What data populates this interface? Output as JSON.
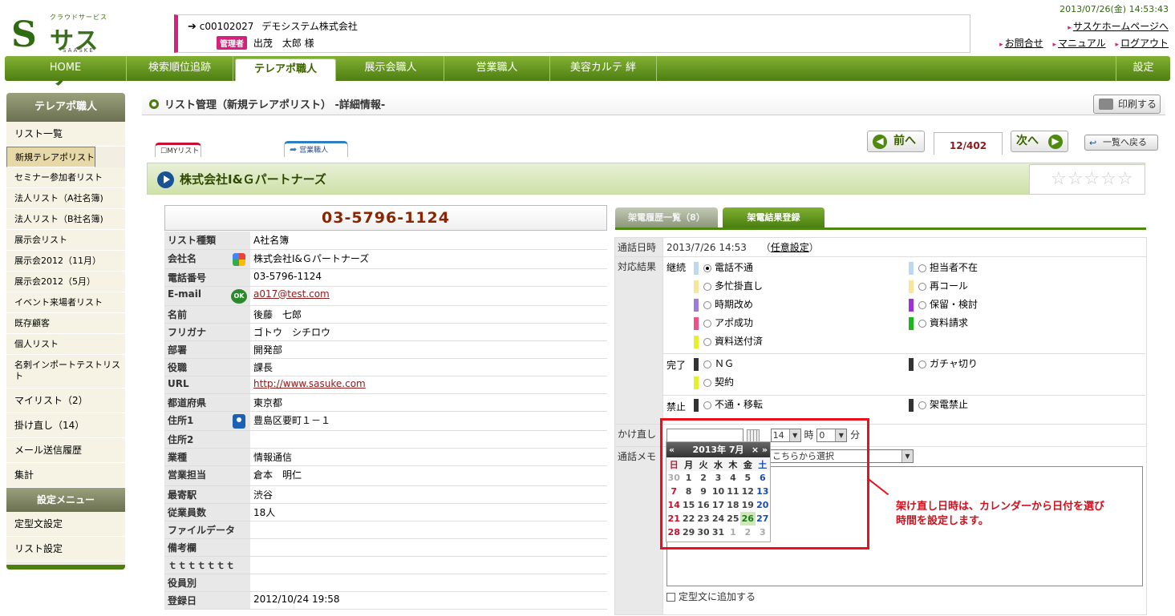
{
  "header": {
    "logo_sub": "クラウドサービス",
    "logo_main": "サスケ",
    "logo_en": "SAASKE",
    "account_id": "c00102027",
    "company": "デモシステム株式会社",
    "role_badge": "管理者",
    "user": "出茂　太郎 様",
    "datetime": "2013/07/26(金) 14:53:43",
    "links": [
      "サスケホームページへ",
      "お問合せ",
      "マニュアル",
      "ログアウト"
    ]
  },
  "nav": {
    "items": [
      "HOME",
      "検索順位追跡",
      "テレアポ職人",
      "展示会職人",
      "営業職人",
      "美容カルテ 絆"
    ],
    "active": "テレアポ職人",
    "settings": "設定"
  },
  "sidebar": {
    "title": "テレアポ職人",
    "items": [
      "リスト一覧",
      "新規テレアポリスト",
      "セミナー参加者リスト",
      "法人リスト（A社名簿)",
      "法人リスト（B社名簿)",
      "展示会リスト",
      "展示会2012（11月）",
      "展示会2012（5月）",
      "イベント来場者リスト",
      "既存顧客",
      "個人リスト",
      "名刺インポートテストリスト",
      "マイリスト（2）",
      "掛け直し（14）",
      "メール送信履歴",
      "集計"
    ],
    "selected": "新規テレアポリスト",
    "settings_title": "設定メニュー",
    "settings_items": [
      "定型文設定",
      "リスト設定"
    ]
  },
  "page": {
    "title": "リスト管理（新規テレアポリスト） -詳細情報-",
    "print": "印刷する",
    "tab_my": "MYリスト",
    "tab_sales": "営業職人",
    "prev": "前へ",
    "next": "次へ",
    "pager": "12/402",
    "back": "一覧へ戻る",
    "company_name": "株式会社I&Ｇパートナーズ",
    "stars": "☆☆☆☆☆",
    "phone": "03-5796-1124"
  },
  "info": [
    {
      "k": "リスト種類",
      "v": "A社名簿",
      "icon": ""
    },
    {
      "k": "会社名",
      "v": "株式会社I&Ｇパートナーズ",
      "icon": "g"
    },
    {
      "k": "電話番号",
      "v": "03-5796-1124",
      "icon": ""
    },
    {
      "k": "E-mail",
      "v": "a017@test.com",
      "icon": "m",
      "link": true
    },
    {
      "k": "名前",
      "v": "後藤　七郎",
      "icon": ""
    },
    {
      "k": "フリガナ",
      "v": "ゴトウ　シチロウ",
      "icon": ""
    },
    {
      "k": "部署",
      "v": "開発部",
      "icon": ""
    },
    {
      "k": "役職",
      "v": "課長",
      "icon": ""
    },
    {
      "k": "URL",
      "v": "http://www.sasuke.com",
      "icon": "",
      "link": true
    },
    {
      "k": "都道府県",
      "v": "東京都",
      "icon": ""
    },
    {
      "k": "住所1",
      "v": "豊島区要町１－１",
      "icon": "pin"
    },
    {
      "k": "住所2",
      "v": "",
      "icon": ""
    },
    {
      "k": "業種",
      "v": "情報通信",
      "icon": ""
    },
    {
      "k": "営業担当",
      "v": "倉本　明仁",
      "icon": ""
    },
    {
      "k": "最寄駅",
      "v": "渋谷",
      "icon": ""
    },
    {
      "k": "従業員数",
      "v": "18人",
      "icon": ""
    },
    {
      "k": "ファイルデータ",
      "v": "",
      "icon": ""
    },
    {
      "k": "備考欄",
      "v": "",
      "icon": ""
    },
    {
      "k": "ｔｔｔｔｔｔｔ",
      "v": "",
      "icon": ""
    },
    {
      "k": "役員別",
      "v": "",
      "icon": ""
    },
    {
      "k": "登録日",
      "v": "2012/10/24 19:58",
      "icon": ""
    }
  ],
  "right": {
    "tabs": [
      "架電履歴一覧（8）",
      "架電結果登録"
    ],
    "call_time_label": "通話日時",
    "call_time": "2013/7/26 14:53",
    "call_time_link": "任意設定",
    "result_label": "対応結果",
    "groups": {
      "cont": "継続",
      "done": "完了",
      "ban": "禁止"
    },
    "results": {
      "r1": {
        "label": "電話不通",
        "color": "#bcd9f2",
        "checked": true
      },
      "r2": {
        "label": "多忙掛直し",
        "color": "#f7e59a",
        "checked": false
      },
      "r3": {
        "label": "時期改め",
        "color": "#9b7bdc",
        "checked": false
      },
      "r4": {
        "label": "アポ成功",
        "color": "#f0508a",
        "checked": false
      },
      "r5": {
        "label": "資料送付済",
        "color": "#e6ef2a",
        "checked": false
      },
      "r6": {
        "label": "担当者不在",
        "color": "#bcd9f2",
        "checked": false
      },
      "r7": {
        "label": "再コール",
        "color": "#f7e59a",
        "checked": false
      },
      "r8": {
        "label": "保留・検討",
        "color": "#9b34d6",
        "checked": false
      },
      "r9": {
        "label": "資料請求",
        "color": "#1fb51f",
        "checked": false
      },
      "r10": {
        "label": "ＮＧ",
        "color": "#333333",
        "checked": false
      },
      "r11": {
        "label": "契約",
        "color": "#e6ef2a",
        "checked": false
      },
      "r12": {
        "label": "ガチャ切り",
        "color": "#333333",
        "checked": false
      },
      "r13": {
        "label": "不通・移転",
        "color": "#333333",
        "checked": false
      },
      "r14": {
        "label": "架電禁止",
        "color": "#333333",
        "checked": false
      }
    },
    "recall_label": "かけ直し",
    "hour": "14",
    "hour_unit": "時",
    "minute": "0",
    "minute_unit": "分",
    "memo_label": "通話メモ",
    "memo_select": "こちらから選択",
    "template_check": "定型文に追加する"
  },
  "calendar": {
    "title": "2013年 7月",
    "prev": "«",
    "next": "× »",
    "weekdays": [
      "日",
      "月",
      "火",
      "水",
      "木",
      "金",
      "土"
    ],
    "weeks": [
      [
        "30",
        "1",
        "2",
        "3",
        "4",
        "5",
        "6"
      ],
      [
        "7",
        "8",
        "9",
        "10",
        "11",
        "12",
        "13"
      ],
      [
        "14",
        "15",
        "16",
        "17",
        "18",
        "19",
        "20"
      ],
      [
        "21",
        "22",
        "23",
        "24",
        "25",
        "26",
        "27"
      ],
      [
        "28",
        "29",
        "30",
        "31",
        "1",
        "2",
        "3"
      ]
    ],
    "today": "26"
  },
  "annotation": [
    "架け直し日時は、カレンダーから日付を選び",
    "時間を設定します。"
  ],
  "colors": {
    "brand": "#4d7e12",
    "accent": "#d4217c",
    "note": "#d10f1c"
  }
}
